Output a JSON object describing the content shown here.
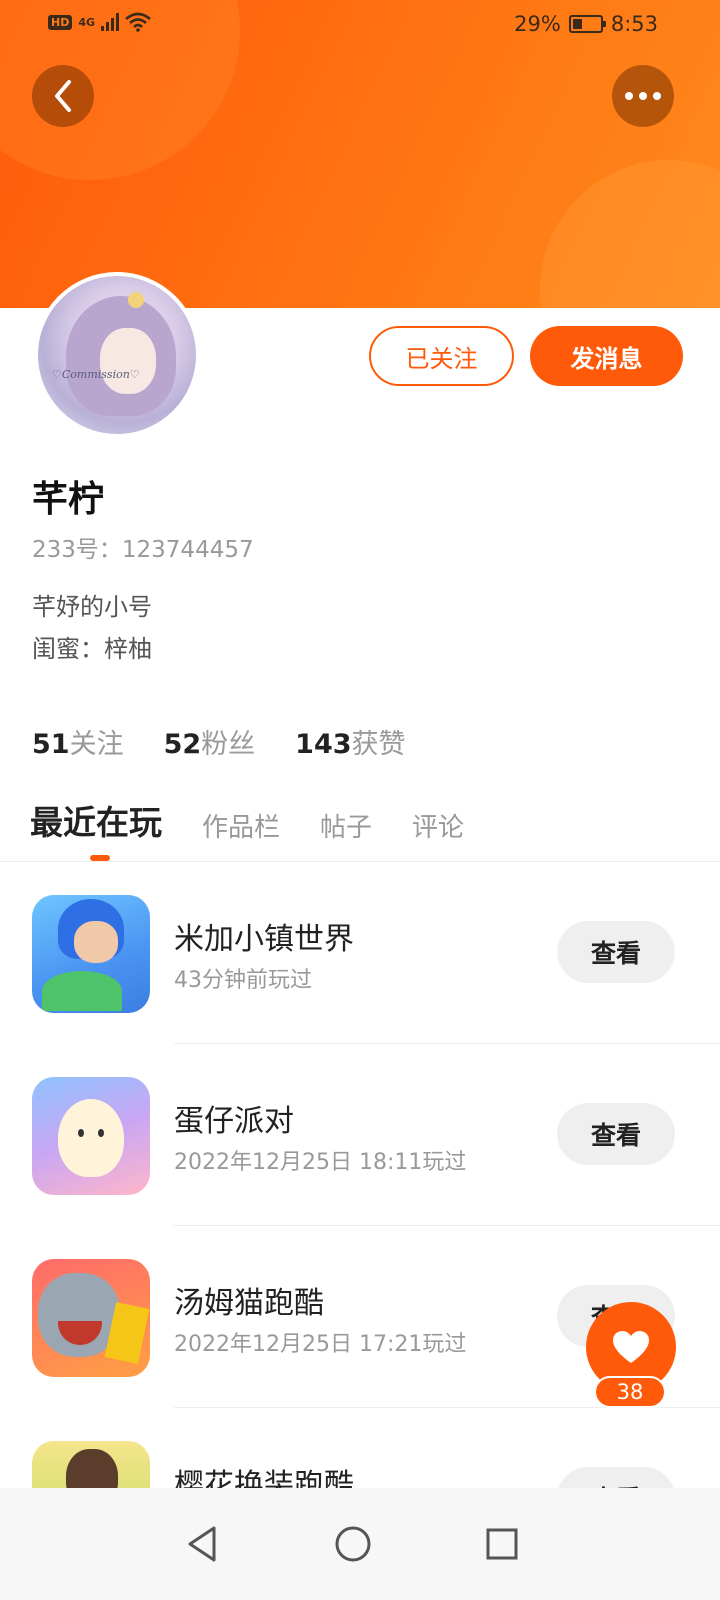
{
  "status_bar": {
    "hd": "HD",
    "network": "4G",
    "battery_percent": "29%",
    "time": "8:53"
  },
  "header": {
    "back_icon": "chevron-left-icon",
    "more_icon": "more-horizontal-icon",
    "gradient_start": "#ff5a0a",
    "gradient_end": "#ff8a1c"
  },
  "profile": {
    "avatar_signature": "♡Commission♡",
    "name": "芊柠",
    "uid": "233号：123744457",
    "bio_lines": [
      "芊妤的小号",
      "闺蜜：梓柚"
    ],
    "followed_label": "已关注",
    "message_label": "发消息"
  },
  "stats": [
    {
      "num": "51",
      "label": "关注"
    },
    {
      "num": "52",
      "label": "粉丝"
    },
    {
      "num": "143",
      "label": "获赞"
    }
  ],
  "tabs": [
    {
      "label": "最近在玩",
      "active": true
    },
    {
      "label": "作品栏",
      "active": false
    },
    {
      "label": "帖子",
      "active": false
    },
    {
      "label": "评论",
      "active": false
    }
  ],
  "games": [
    {
      "title": "米加小镇世界",
      "time": "43分钟前玩过",
      "button": "查看"
    },
    {
      "title": "蛋仔派对",
      "time": "2022年12月25日 18:11玩过",
      "button": "查看"
    },
    {
      "title": "汤姆猫跑酷",
      "time": "2022年12月25日 17:21玩过",
      "button": "查看"
    },
    {
      "title": "樱花换装跑酷",
      "time": "",
      "button": "查看"
    }
  ],
  "like_fab": {
    "icon": "heart-icon",
    "count": "38"
  },
  "accent_color": "#ff5a0a",
  "nav": {
    "back_icon": "triangle-back-icon",
    "home_icon": "circle-home-icon",
    "recents_icon": "square-recents-icon"
  }
}
